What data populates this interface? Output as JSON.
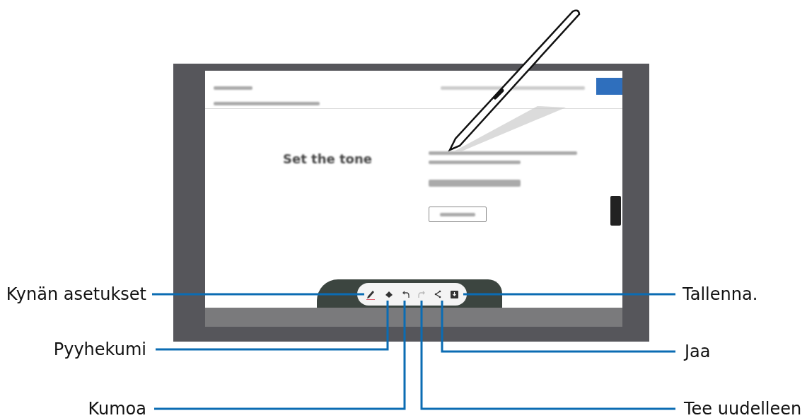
{
  "screen": {
    "heading": "Set the tone",
    "toolbar": [
      {
        "kind": "pen"
      },
      {
        "kind": "eraser"
      },
      {
        "kind": "undo"
      },
      {
        "kind": "redo"
      },
      {
        "kind": "share"
      },
      {
        "kind": "save"
      }
    ]
  },
  "callouts": [
    {
      "text": "Kynän asetukset"
    },
    {
      "text": "Pyyhekumi"
    },
    {
      "text": "Kumoa"
    },
    {
      "text": "Tallenna."
    },
    {
      "text": "Jaa"
    },
    {
      "text": "Tee uudelleen"
    }
  ]
}
